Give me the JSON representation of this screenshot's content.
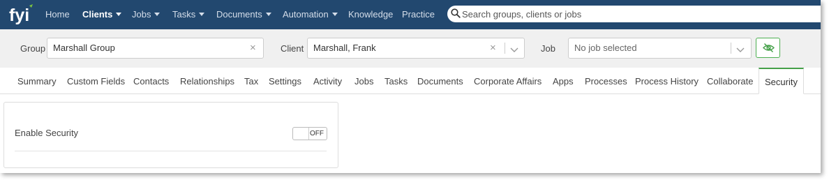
{
  "app": {
    "logo_text": "fyi",
    "brand_color": "#22486f",
    "accent_color": "#45a049"
  },
  "nav": {
    "items": [
      {
        "label": "Home",
        "dropdown": false,
        "active": false
      },
      {
        "label": "Clients",
        "dropdown": true,
        "active": true
      },
      {
        "label": "Jobs",
        "dropdown": true,
        "active": false
      },
      {
        "label": "Tasks",
        "dropdown": true,
        "active": false
      },
      {
        "label": "Documents",
        "dropdown": true,
        "active": false
      },
      {
        "label": "Automation",
        "dropdown": true,
        "active": false
      },
      {
        "label": "Knowledge",
        "dropdown": false,
        "active": false
      },
      {
        "label": "Practice",
        "dropdown": false,
        "active": false
      }
    ],
    "search": {
      "placeholder": "Search groups, clients or jobs",
      "value": "",
      "icon": "search-icon"
    }
  },
  "selectors": {
    "group": {
      "label": "Group",
      "value": "Marshall Group"
    },
    "client": {
      "label": "Client",
      "value": "Marshall, Frank"
    },
    "job": {
      "label": "Job",
      "value": "No job selected"
    },
    "visibility_button_icon": "eye-slash-icon"
  },
  "tabs": [
    {
      "label": "Summary",
      "active": false
    },
    {
      "label": "Custom Fields",
      "active": false
    },
    {
      "label": "Contacts",
      "active": false
    },
    {
      "label": "Relationships",
      "active": false
    },
    {
      "label": "Tax",
      "active": false
    },
    {
      "label": "Settings",
      "active": false
    },
    {
      "label": "Activity",
      "active": false
    },
    {
      "label": "Jobs",
      "active": false
    },
    {
      "label": "Tasks",
      "active": false
    },
    {
      "label": "Documents",
      "active": false
    },
    {
      "label": "Corporate Affairs",
      "active": false
    },
    {
      "label": "Apps",
      "active": false
    },
    {
      "label": "Processes",
      "active": false
    },
    {
      "label": "Process History",
      "active": false
    },
    {
      "label": "Collaborate",
      "active": false
    },
    {
      "label": "Security",
      "active": true
    }
  ],
  "security": {
    "enable_label": "Enable Security",
    "toggle_state": "OFF"
  }
}
